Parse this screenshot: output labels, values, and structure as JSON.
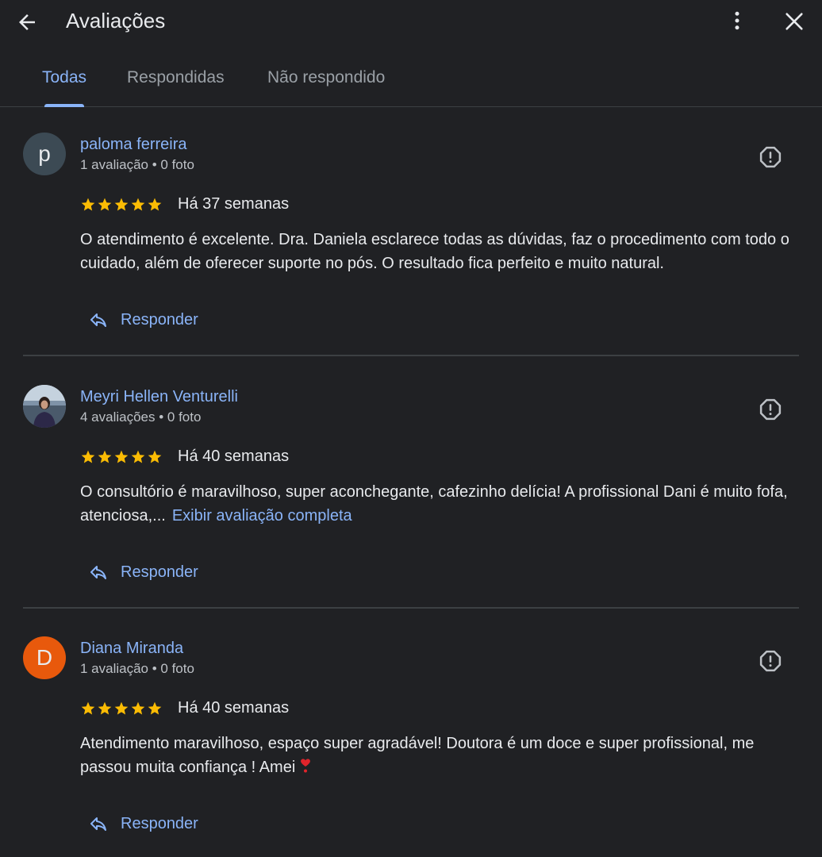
{
  "header": {
    "title": "Avaliações"
  },
  "tabs": [
    {
      "label": "Todas",
      "active": true
    },
    {
      "label": "Respondidas",
      "active": false
    },
    {
      "label": "Não respondido",
      "active": false
    }
  ],
  "colors": {
    "background": "#202124",
    "accent": "#8ab4f8",
    "star": "#fbbc04",
    "divider": "#3c4043"
  },
  "reviews": [
    {
      "author": "paloma ferreira",
      "avatar_letter": "p",
      "avatar_color": "#3c4a54",
      "meta": "1 avaliação • 0 foto",
      "rating": 5,
      "time": "Há 37 semanas",
      "text": "O atendimento é excelente. Dra. Daniela esclarece todas as dúvidas, faz o procedimento com todo o cuidado, além de oferecer suporte no pós. O resultado fica perfeito e muito natural.",
      "reply_label": "Responder"
    },
    {
      "author": "Meyri Hellen Venturelli",
      "avatar_letter": "",
      "avatar_color": "",
      "meta": "4 avaliações • 0 foto",
      "rating": 5,
      "time": "Há 40 semanas",
      "text": "O consultório é maravilhoso, super aconchegante, cafezinho delícia! A profissional Dani é muito fofa, atenciosa,...",
      "expand_link": "Exibir avaliação completa",
      "reply_label": "Responder"
    },
    {
      "author": "Diana Miranda",
      "avatar_letter": "D",
      "avatar_color": "#e8590c",
      "meta": "1 avaliação • 0 foto",
      "rating": 5,
      "time": "Há 40 semanas",
      "text": "Atendimento maravilhoso, espaço super agradável! Doutora é um doce e super profissional, me passou muita confiança ! Amei",
      "reply_label": "Responder"
    }
  ]
}
